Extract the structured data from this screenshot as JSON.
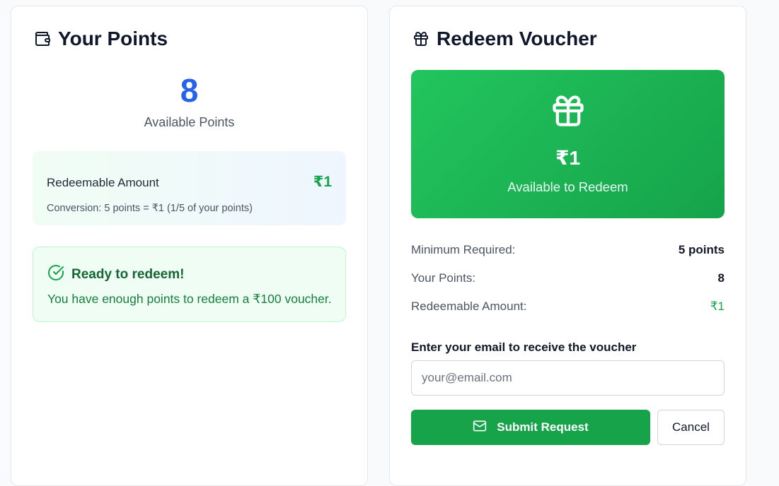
{
  "points_card": {
    "title": "Your Points",
    "title_icon": "wallet-icon",
    "points_value": "8",
    "points_caption": "Available Points",
    "redeemable": {
      "label": "Redeemable Amount",
      "amount": "₹1",
      "conversion": "Conversion: 5 points = ₹1 (1/5 of your points)"
    },
    "ready": {
      "icon": "check-circle-icon",
      "heading": "Ready to redeem!",
      "text": "You have enough points to redeem a ₹100 voucher."
    }
  },
  "voucher_card": {
    "title": "Redeem Voucher",
    "title_icon": "gift-icon",
    "panel": {
      "icon": "gift-icon",
      "amount": "₹1",
      "caption": "Available to Redeem"
    },
    "info": {
      "min_label": "Minimum Required:",
      "min_value": "5 points",
      "points_label": "Your Points:",
      "points_value": "8",
      "amount_label": "Redeemable Amount:",
      "amount_value": "₹1"
    },
    "email_label": "Enter your email to receive the voucher",
    "email_placeholder": "your@email.com",
    "submit_label": "Submit Request",
    "submit_icon": "mail-icon",
    "cancel_label": "Cancel"
  },
  "colors": {
    "accent_blue": "#2563eb",
    "accent_green": "#16a34a"
  }
}
